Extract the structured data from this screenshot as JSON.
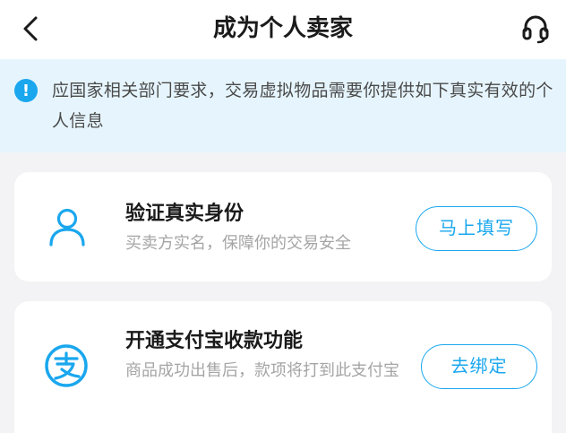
{
  "header": {
    "title": "成为个人卖家",
    "back_icon": "chevron-left-icon",
    "support_icon": "headset-icon"
  },
  "notice": {
    "icon": "info-icon",
    "icon_glyph": "!",
    "text": "应国家相关部门要求，交易虚拟物品需要你提供如下真实有效的个人信息"
  },
  "cards": [
    {
      "icon": "user-icon",
      "title": "验证真实身份",
      "description": "买卖方实名，保障你的交易安全",
      "button_label": "马上填写"
    },
    {
      "icon": "alipay-icon",
      "title": "开通支付宝收款功能",
      "description": "商品成功出售后，款项将打到此支付宝",
      "button_label": "去绑定"
    }
  ],
  "colors": {
    "accent": "#1aa7ee",
    "notice_bg": "#e6f5fd",
    "page_bg": "#f3f3f5"
  }
}
